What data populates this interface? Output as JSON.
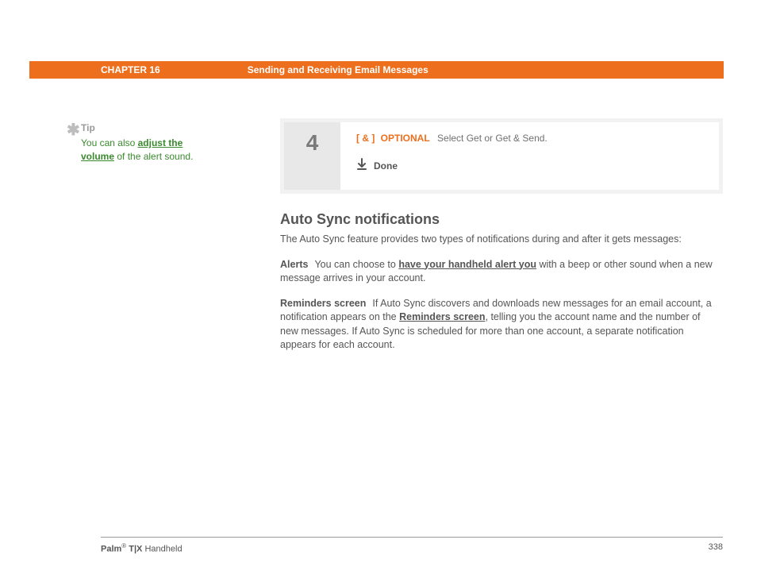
{
  "header": {
    "chapter": "CHAPTER 16",
    "title": "Sending and Receiving Email Messages"
  },
  "tip": {
    "label": "Tip",
    "before": "You can also ",
    "link": "adjust the volume",
    "after": " of the alert sound."
  },
  "step": {
    "number": "4",
    "optional_prefix": "[ & ]",
    "optional_label": "OPTIONAL",
    "instruction": "Select Get or Get & Send.",
    "done": "Done"
  },
  "section": {
    "heading": "Auto Sync notifications",
    "intro": "The Auto Sync feature provides two types of notifications during and after it gets messages:",
    "alerts_label": "Alerts",
    "alerts_before": "You can choose to ",
    "alerts_link": "have your handheld alert you",
    "alerts_after": " with a beep or other sound when a new message arrives in your account.",
    "reminders_label": "Reminders screen",
    "reminders_before": "If Auto Sync discovers and downloads new messages for an email account, a notification appears on the ",
    "reminders_link": "Reminders screen",
    "reminders_after": ", telling you the account name and the number of new messages. If Auto Sync is scheduled for more than one account, a separate notification appears for each account."
  },
  "footer": {
    "brand_a": "Palm",
    "reg": "®",
    "brand_b": " T|X",
    "product": " Handheld",
    "page": "338"
  }
}
